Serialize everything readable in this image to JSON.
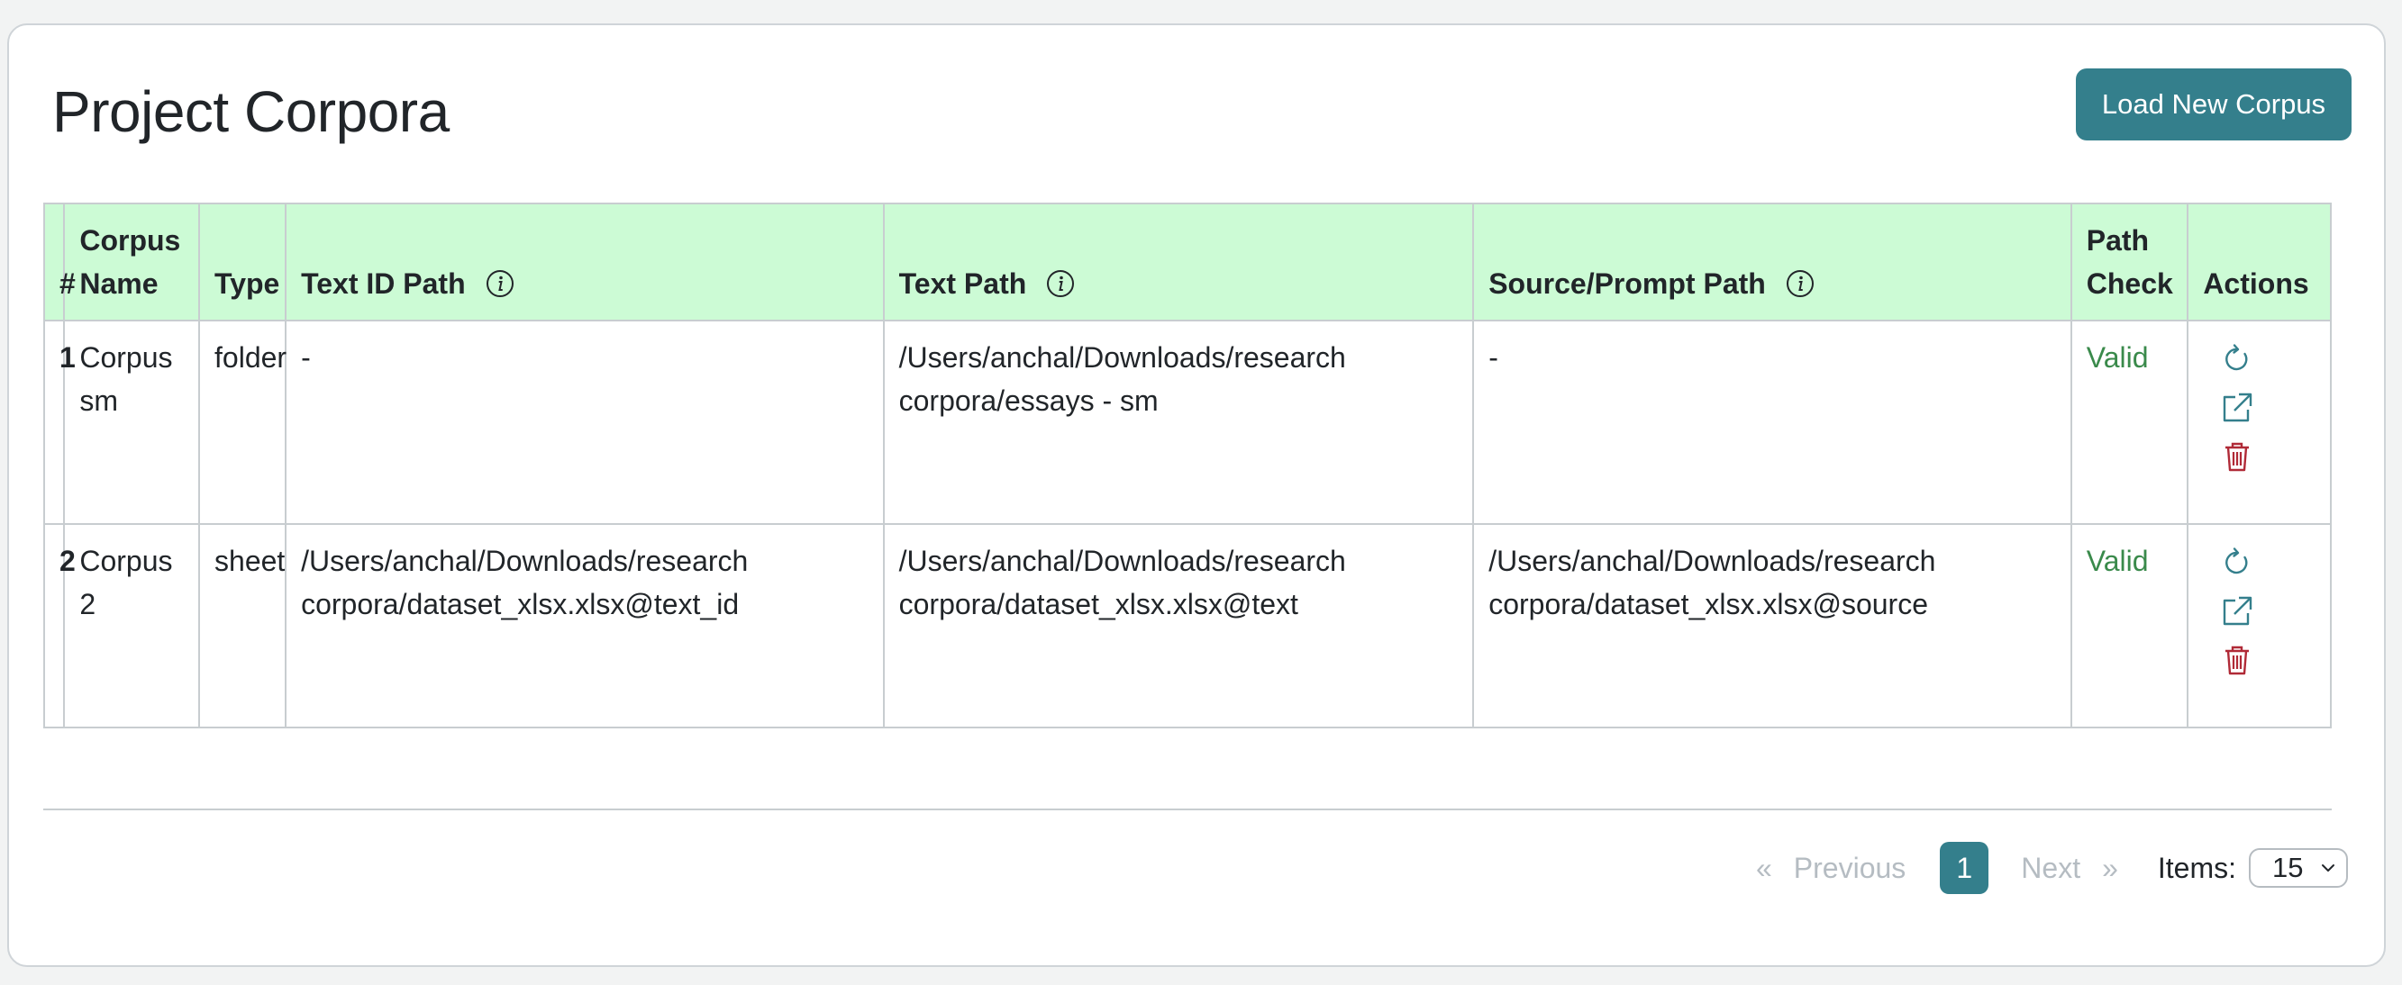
{
  "page": {
    "title": "Project Corpora",
    "load_button_label": "Load New Corpus"
  },
  "table": {
    "headers": {
      "num": "#",
      "name": "Corpus Name",
      "type": "Type",
      "text_id_path": "Text ID Path",
      "text_path": "Text Path",
      "source_path": "Source/Prompt Path",
      "path_check": "Path Check",
      "actions": "Actions"
    },
    "rows": [
      {
        "num": "1",
        "name": "Corpus sm",
        "type": "folder",
        "text_id_path": "-",
        "text_path": "/Users/anchal/Downloads/research corpora/essays - sm",
        "source_path": "-",
        "path_check": "Valid"
      },
      {
        "num": "2",
        "name": "Corpus 2",
        "type": "sheet",
        "text_id_path": "/Users/anchal/Downloads/research corpora/dataset_xlsx.xlsx@text_id",
        "text_path": "/Users/anchal/Downloads/research corpora/dataset_xlsx.xlsx@text",
        "source_path": "/Users/anchal/Downloads/research corpora/dataset_xlsx.xlsx@source",
        "path_check": "Valid"
      }
    ],
    "action_icons": [
      "refresh-icon",
      "external-link-icon",
      "trash-icon"
    ]
  },
  "pagination": {
    "prev_arrow": "«",
    "prev_label": "Previous",
    "current_page": "1",
    "next_label": "Next",
    "next_arrow": "»",
    "items_label": "Items:",
    "items_value": "15"
  },
  "colors": {
    "accent": "#347f8c",
    "header_bg": "#ccfbd5",
    "valid": "#3a8a4b",
    "danger": "#b02a37",
    "icon_teal": "#347f8c",
    "muted": "#b5bcc2"
  }
}
